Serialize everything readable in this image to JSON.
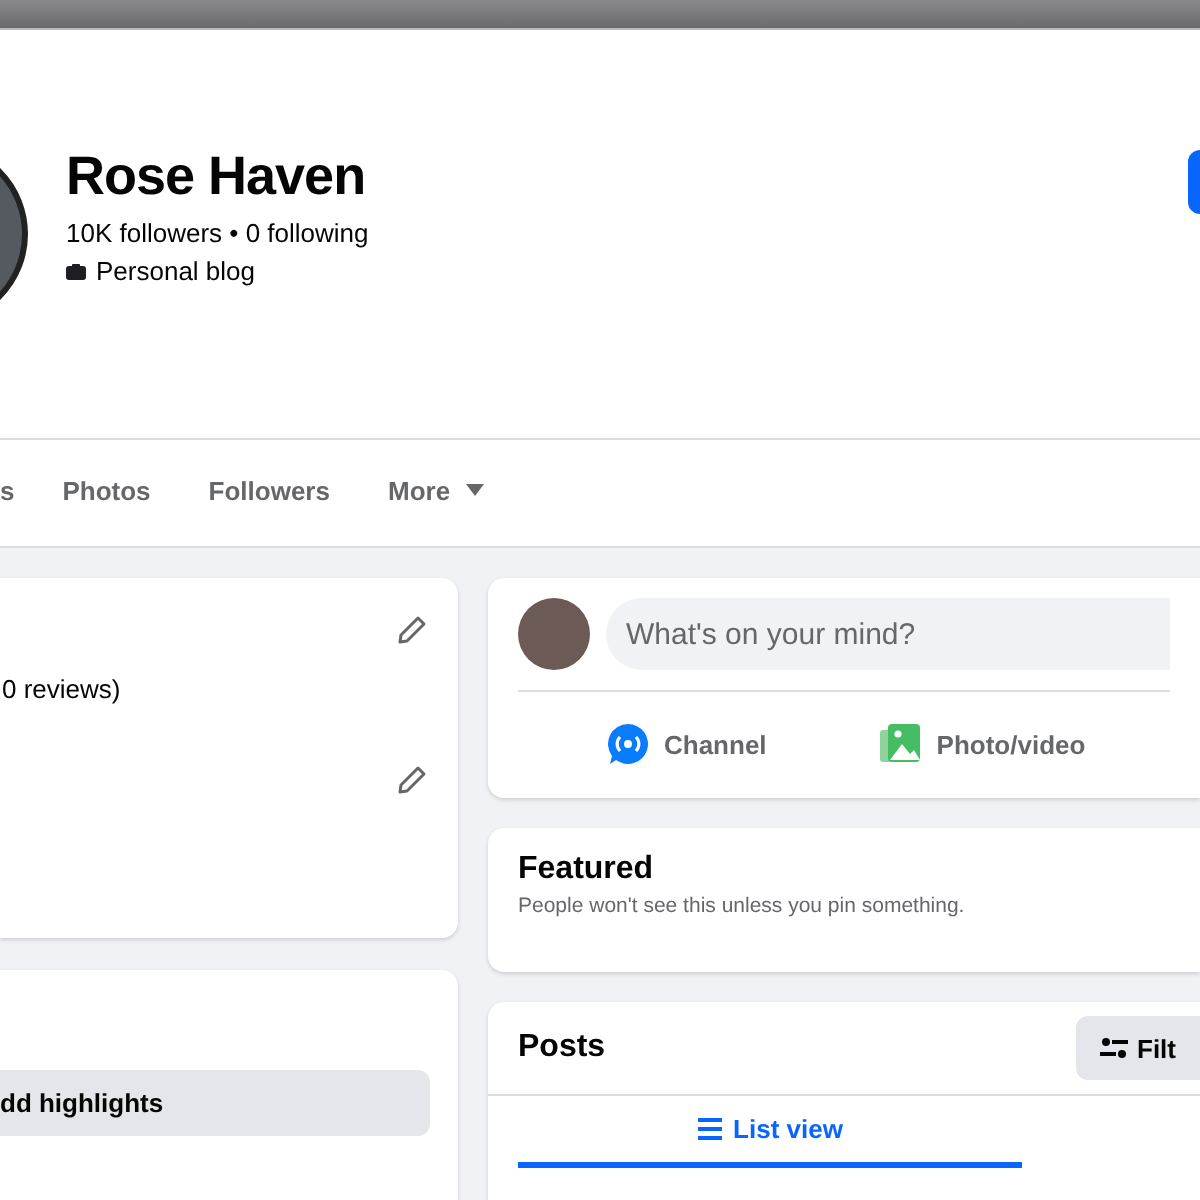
{
  "profile": {
    "name": "Rose Haven",
    "stats": "10K followers • 0 following",
    "category": "Personal blog"
  },
  "tabs": [
    {
      "label": "s",
      "selected": false,
      "has_menu": false
    },
    {
      "label": "Photos",
      "selected": false,
      "has_menu": false
    },
    {
      "label": "Followers",
      "selected": false,
      "has_menu": false
    },
    {
      "label": "More",
      "selected": false,
      "has_menu": true
    }
  ],
  "intro_card": {
    "text": "0 reviews)"
  },
  "highlights_card": {
    "button": "dd highlights"
  },
  "composer": {
    "placeholder": "What's on your mind?",
    "actions": [
      {
        "kind": "channel",
        "label": "Channel"
      },
      {
        "kind": "photo",
        "label": "Photo/video"
      }
    ]
  },
  "featured": {
    "title": "Featured",
    "subtitle": "People won't see this unless you pin something."
  },
  "posts": {
    "title": "Posts",
    "filter_button": "Filt",
    "views": [
      {
        "label": "List view",
        "selected": true
      }
    ]
  }
}
